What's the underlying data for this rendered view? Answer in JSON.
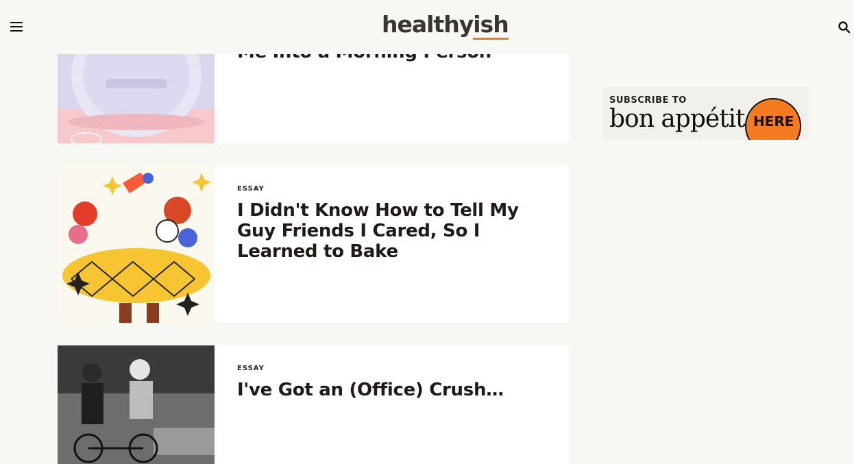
{
  "header": {
    "logo_main": "healthy",
    "logo_suffix": "ish",
    "menu_icon": "hamburger-menu-icon",
    "search_icon": "search-icon"
  },
  "articles": [
    {
      "kicker": "",
      "headline": "Me Into a Morning Person"
    },
    {
      "kicker": "ESSAY",
      "headline": "I Didn't Know How to Tell My Guy Friends I Cared, So I Learned to Bake"
    },
    {
      "kicker": "ESSAY",
      "headline": "I've Got an (Office) Crush…"
    }
  ],
  "ad": {
    "subscribe_text": "SUBSCRIBE TO",
    "brand": "bon appétit",
    "cta": "HERE"
  },
  "colors": {
    "background": "#f7f7f3",
    "card": "#ffffff",
    "accent": "#f47b20"
  }
}
